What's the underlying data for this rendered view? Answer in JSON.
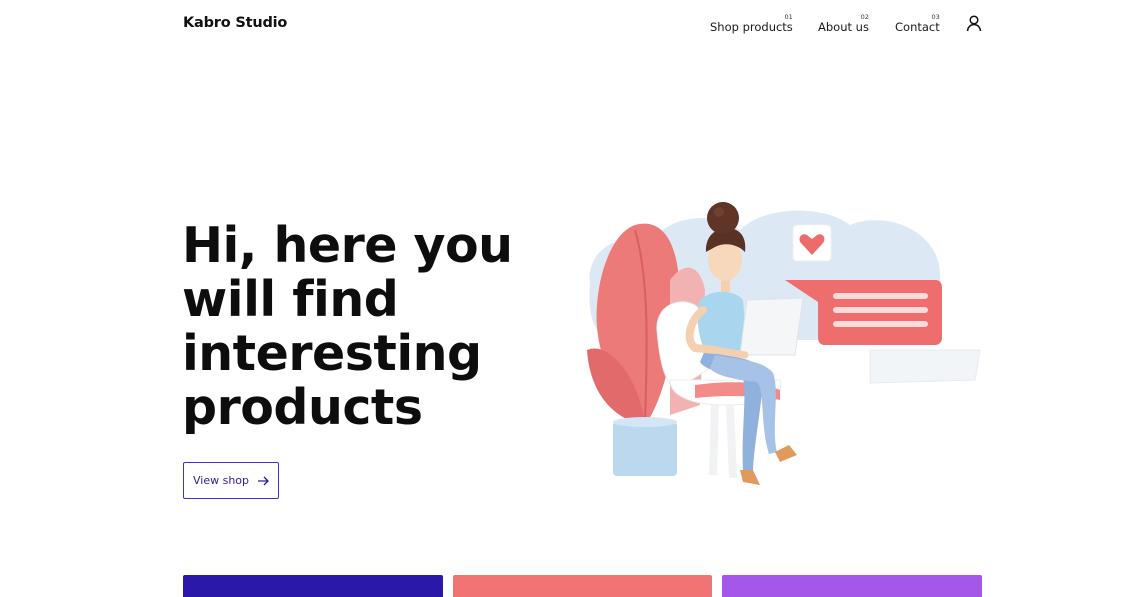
{
  "header": {
    "logo": "Kabro Studio",
    "nav": [
      {
        "label": "Shop products",
        "num": "01"
      },
      {
        "label": "About us",
        "num": "02"
      },
      {
        "label": "Contact",
        "num": "03"
      }
    ],
    "user_icon": "user-icon"
  },
  "hero": {
    "title_lines": [
      "Hi, here you",
      "will find",
      "interesting",
      "products"
    ],
    "cta_label": "View shop",
    "cta_icon": "arrow-right-icon",
    "illustration": "woman-with-laptop-illustration"
  },
  "cards": [
    {
      "color": "#2a18a8"
    },
    {
      "color": "#f27373"
    },
    {
      "color": "#a457e8"
    }
  ],
  "colors": {
    "accent": "#4b2bd6",
    "coral": "#f27373",
    "purple": "#a457e8",
    "navy": "#2a18a8"
  }
}
